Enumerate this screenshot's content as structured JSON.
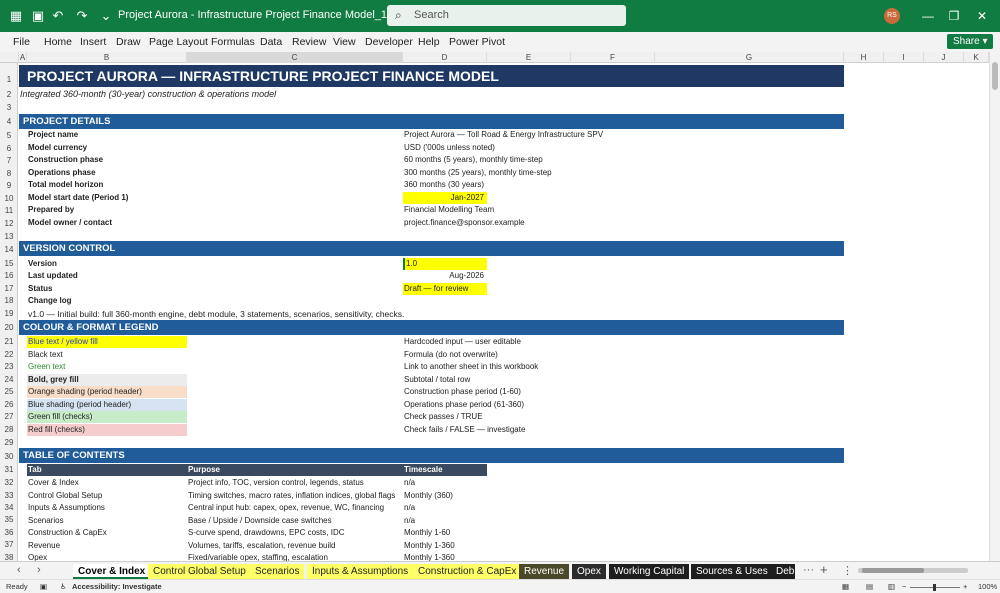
{
  "window": {
    "title": "Project Aurora - Infrastructure Project Finance Model_1.xlsx  -  Excel",
    "search_placeholder": "Search",
    "avatar_initials": "RS"
  },
  "menu": [
    "File",
    "Home",
    "Insert",
    "Draw",
    "Page Layout",
    "Formulas",
    "Data",
    "Review",
    "View",
    "Developer",
    "Help",
    "Power Pivot"
  ],
  "share_label": "Share",
  "columns": [
    "A",
    "B",
    "C",
    "D",
    "E",
    "F",
    "G",
    "H",
    "I",
    "J",
    "K"
  ],
  "rows": [
    "1",
    "2",
    "3",
    "4",
    "5",
    "6",
    "7",
    "8",
    "9",
    "10",
    "11",
    "12",
    "13",
    "14",
    "15",
    "16",
    "17",
    "18",
    "19",
    "20",
    "21",
    "22",
    "23",
    "24",
    "25",
    "26",
    "27",
    "28",
    "29",
    "30",
    "31",
    "32",
    "33",
    "34",
    "35",
    "36",
    "37",
    "38",
    "39"
  ],
  "sheet": {
    "title": "PROJECT AURORA — INFRASTRUCTURE PROJECT FINANCE MODEL",
    "subtitle": "Integrated 360-month (30-year) construction & operations model",
    "sections": {
      "project_details": "PROJECT DETAILS",
      "version_control": "VERSION CONTROL",
      "legend": "COLOUR & FORMAT LEGEND",
      "toc": "TABLE OF CONTENTS"
    },
    "details": [
      {
        "label": "Project name",
        "value": "Project Aurora — Toll Road & Energy Infrastructure SPV"
      },
      {
        "label": "Model currency",
        "value": "USD ('000s unless noted)"
      },
      {
        "label": "Construction phase",
        "value": "60 months (5 years), monthly time-step"
      },
      {
        "label": "Operations phase",
        "value": "300 months (25 years), monthly time-step"
      },
      {
        "label": "Total model horizon",
        "value": "360 months (30 years)"
      },
      {
        "label": "Model start date (Period 1)",
        "value": "Jan-2027"
      },
      {
        "label": "Prepared by",
        "value": "Financial Modelling Team"
      },
      {
        "label": "Model owner / contact",
        "value": "project.finance@sponsor.example"
      }
    ],
    "version": [
      {
        "label": "Version",
        "value": "1.0"
      },
      {
        "label": "Last updated",
        "value": "Aug-2026"
      },
      {
        "label": "Status",
        "value": "Draft — for review"
      },
      {
        "label": "Change log",
        "value": ""
      }
    ],
    "changelog_entry": "v1.0 — Initial build: full 360-month engine, debt module, 3 statements, scenarios, sensitivity, checks.",
    "legend_items": [
      {
        "swatch": "Blue text / yellow fill",
        "desc": "Hardcoded input — user editable",
        "bg": "#ffff00",
        "fg": "#1f3fbf"
      },
      {
        "swatch": "Black text",
        "desc": "Formula (do not overwrite)",
        "bg": "#ffffff",
        "fg": "#000000"
      },
      {
        "swatch": "Green text",
        "desc": "Link to another sheet in this workbook",
        "bg": "#ffffff",
        "fg": "#2e8b2e"
      },
      {
        "swatch": "Bold, grey fill",
        "desc": "Subtotal / total row",
        "bg": "#ececec",
        "fg": "#000000"
      },
      {
        "swatch": "Orange shading (period header)",
        "desc": "Construction phase period (1-60)",
        "bg": "#f8ddc8",
        "fg": "#000000"
      },
      {
        "swatch": "Blue shading (period header)",
        "desc": "Operations phase period (61-360)",
        "bg": "#d6e3f2",
        "fg": "#000000"
      },
      {
        "swatch": "Green fill (checks)",
        "desc": "Check passes / TRUE",
        "bg": "#c8ecc8",
        "fg": "#000000"
      },
      {
        "swatch": "Red fill (checks)",
        "desc": "Check fails / FALSE — investigate",
        "bg": "#f6cccc",
        "fg": "#000000"
      }
    ],
    "toc_headers": {
      "tab": "Tab",
      "purpose": "Purpose",
      "timescale": "Timescale"
    },
    "toc": [
      {
        "tab": "Cover & Index",
        "purpose": "Project info, TOC, version control, legends, status",
        "timescale": "n/a"
      },
      {
        "tab": "Control Global Setup",
        "purpose": "Timing switches, macro rates, inflation indices, global flags",
        "timescale": "Monthly (360)"
      },
      {
        "tab": "Inputs & Assumptions",
        "purpose": "Central input hub: capex, opex, revenue, WC, financing",
        "timescale": "n/a"
      },
      {
        "tab": "Scenarios",
        "purpose": "Base / Upside / Downside case switches",
        "timescale": "n/a"
      },
      {
        "tab": "Construction & CapEx",
        "purpose": "S-curve spend, drawdowns, EPC costs, IDC",
        "timescale": "Monthly 1-60"
      },
      {
        "tab": "Revenue",
        "purpose": "Volumes, tariffs, escalation, revenue build",
        "timescale": "Monthly 1-360"
      },
      {
        "tab": "Opex",
        "purpose": "Fixed/variable opex, staffing, escalation",
        "timescale": "Monthly 1-360"
      }
    ]
  },
  "sheet_tabs": [
    {
      "label": "Cover & Index",
      "bg": "#ffffff",
      "fg": "#000000",
      "active": true
    },
    {
      "label": "Control Global Setup",
      "bg": "#ffff66",
      "fg": "#000000"
    },
    {
      "label": "Scenarios",
      "bg": "#ffff66",
      "fg": "#000000"
    },
    {
      "label": "Inputs & Assumptions",
      "bg": "#ffff66",
      "fg": "#000000"
    },
    {
      "label": "Construction & CapEx",
      "bg": "#ffff66",
      "fg": "#000000"
    },
    {
      "label": "Revenue",
      "bg": "#4a4a2a",
      "fg": "#ffffff"
    },
    {
      "label": "Opex",
      "bg": "#2b2b2b",
      "fg": "#ffffff"
    },
    {
      "label": "Working Capital",
      "bg": "#1e1e1e",
      "fg": "#ffffff"
    },
    {
      "label": "Sources & Uses",
      "bg": "#1e1e1e",
      "fg": "#ffffff"
    },
    {
      "label": "Deb",
      "bg": "#1e1e1e",
      "fg": "#ffffff"
    }
  ],
  "status": {
    "ready": "Ready",
    "accessibility": "Accessibility: Investigate",
    "zoom": "100%"
  },
  "colors": {
    "excel_green": "#107c41",
    "section_blue": "#1f5c99",
    "title_navy": "#1f3864",
    "input_yellow": "#ffff00"
  }
}
